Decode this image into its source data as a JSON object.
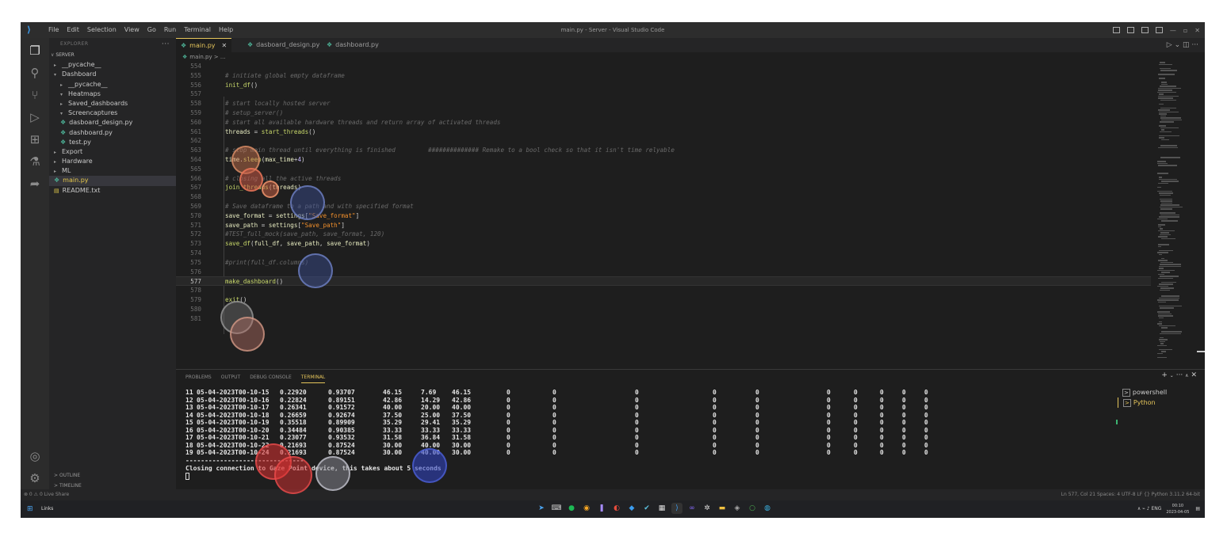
{
  "titlebar": {
    "menu": [
      "File",
      "Edit",
      "Selection",
      "View",
      "Go",
      "Run",
      "Terminal",
      "Help"
    ],
    "title": "main.py - Server - Visual Studio Code"
  },
  "explorer": {
    "header": "EXPLORER",
    "root": "SERVER",
    "items": [
      {
        "label": "__pycache__",
        "level": 1,
        "kind": "folder",
        "open": false
      },
      {
        "label": "Dashboard",
        "level": 1,
        "kind": "folder",
        "open": true
      },
      {
        "label": "__pycache__",
        "level": 2,
        "kind": "folder",
        "open": false
      },
      {
        "label": "Heatmaps",
        "level": 2,
        "kind": "folder",
        "open": true
      },
      {
        "label": "Saved_dashboards",
        "level": 2,
        "kind": "folder",
        "open": false
      },
      {
        "label": "Screencaptures",
        "level": 2,
        "kind": "folder",
        "open": true
      },
      {
        "label": "dasboard_design.py",
        "level": 2,
        "kind": "py"
      },
      {
        "label": "dashboard.py",
        "level": 2,
        "kind": "py"
      },
      {
        "label": "test.py",
        "level": 2,
        "kind": "py"
      },
      {
        "label": "Export",
        "level": 1,
        "kind": "folder",
        "open": false
      },
      {
        "label": "Hardware",
        "level": 1,
        "kind": "folder",
        "open": false
      },
      {
        "label": "ML",
        "level": 1,
        "kind": "folder",
        "open": false
      },
      {
        "label": "main.py",
        "level": 1,
        "kind": "py",
        "selected": true
      },
      {
        "label": "README.txt",
        "level": 1,
        "kind": "txt"
      }
    ],
    "outline": "OUTLINE",
    "timeline": "TIMELINE"
  },
  "tabs": [
    {
      "label": "main.py",
      "active": true
    },
    {
      "label": "dasboard_design.py",
      "active": false
    },
    {
      "label": "dashboard.py",
      "active": false
    }
  ],
  "breadcrumb": "main.py > ...",
  "code": [
    {
      "n": "554",
      "t": []
    },
    {
      "n": "555",
      "t": [
        [
          "cm",
          "# initiate global empty dataframe"
        ]
      ]
    },
    {
      "n": "556",
      "t": [
        [
          "fn",
          "init_df"
        ],
        [
          "pl",
          "()"
        ]
      ]
    },
    {
      "n": "557",
      "t": []
    },
    {
      "n": "558",
      "t": [
        [
          "cm",
          "# start locally hosted server"
        ]
      ]
    },
    {
      "n": "559",
      "t": [
        [
          "cm",
          "# setup_server()"
        ]
      ]
    },
    {
      "n": "560",
      "t": [
        [
          "cm",
          "# start all available hardware threads and return array of activated threads"
        ]
      ]
    },
    {
      "n": "561",
      "t": [
        [
          "va",
          "threads"
        ],
        [
          "pl",
          " = "
        ],
        [
          "fn",
          "start_threads"
        ],
        [
          "pl",
          "()"
        ]
      ]
    },
    {
      "n": "562",
      "t": []
    },
    {
      "n": "563",
      "t": [
        [
          "cm",
          "# stop main thread until everything is finished         ############## Remake to a bool check so that it isn't time relyable"
        ]
      ]
    },
    {
      "n": "564",
      "t": [
        [
          "va",
          "time"
        ],
        [
          "pl",
          "."
        ],
        [
          "fn",
          "sleep"
        ],
        [
          "pl",
          "("
        ],
        [
          "va",
          "max_time"
        ],
        [
          "pl",
          "+"
        ],
        [
          "nu",
          "4"
        ],
        [
          "pl",
          ")"
        ]
      ]
    },
    {
      "n": "565",
      "t": []
    },
    {
      "n": "566",
      "t": [
        [
          "cm",
          "# closing all the active threads"
        ]
      ]
    },
    {
      "n": "567",
      "t": [
        [
          "fn",
          "join_threads"
        ],
        [
          "pl",
          "("
        ],
        [
          "va",
          "threads"
        ],
        [
          "pl",
          ")"
        ]
      ]
    },
    {
      "n": "568",
      "t": []
    },
    {
      "n": "569",
      "t": [
        [
          "cm",
          "# Save dataframe to a path and with specified format"
        ]
      ]
    },
    {
      "n": "570",
      "t": [
        [
          "va",
          "save_format"
        ],
        [
          "pl",
          " = "
        ],
        [
          "va",
          "settings"
        ],
        [
          "pl",
          "["
        ],
        [
          "st",
          "\"Save_format\""
        ],
        [
          "pl",
          "]"
        ]
      ]
    },
    {
      "n": "571",
      "t": [
        [
          "va",
          "save_path"
        ],
        [
          "pl",
          " = "
        ],
        [
          "va",
          "settings"
        ],
        [
          "pl",
          "["
        ],
        [
          "st",
          "\"Save_path\""
        ],
        [
          "pl",
          "]"
        ]
      ]
    },
    {
      "n": "572",
      "t": [
        [
          "cm",
          "#TEST_full_mock(save_path, save_format, 120)"
        ]
      ]
    },
    {
      "n": "573",
      "t": [
        [
          "fn",
          "save_df"
        ],
        [
          "pl",
          "("
        ],
        [
          "va",
          "full_df"
        ],
        [
          "pl",
          ", "
        ],
        [
          "va",
          "save_path"
        ],
        [
          "pl",
          ", "
        ],
        [
          "va",
          "save_format"
        ],
        [
          "pl",
          ")"
        ]
      ]
    },
    {
      "n": "574",
      "t": []
    },
    {
      "n": "575",
      "t": [
        [
          "cm",
          "#print(full_df.columns)"
        ]
      ]
    },
    {
      "n": "576",
      "t": []
    },
    {
      "n": "577",
      "t": [
        [
          "fn",
          "make_dashboard"
        ],
        [
          "pl",
          "()"
        ]
      ],
      "current": true
    },
    {
      "n": "578",
      "t": []
    },
    {
      "n": "579",
      "t": [
        [
          "fn",
          "exit"
        ],
        [
          "pl",
          "()"
        ]
      ]
    },
    {
      "n": "580",
      "t": []
    },
    {
      "n": "581",
      "t": []
    }
  ],
  "panel": {
    "tabs": [
      "PROBLEMS",
      "OUTPUT",
      "DEBUG CONSOLE",
      "TERMINAL"
    ],
    "active": "TERMINAL",
    "rows": [
      [
        "11",
        "05-04-2023T00-10-15",
        "0.22920",
        "0.93707",
        "46.15",
        "7.69",
        "46.15",
        "0",
        "0",
        "0",
        "0",
        "0",
        "0",
        "0",
        "0",
        "0",
        "0"
      ],
      [
        "12",
        "05-04-2023T00-10-16",
        "0.22824",
        "0.89151",
        "42.86",
        "14.29",
        "42.86",
        "0",
        "0",
        "0",
        "0",
        "0",
        "0",
        "0",
        "0",
        "0",
        "0"
      ],
      [
        "13",
        "05-04-2023T00-10-17",
        "0.26341",
        "0.91572",
        "40.00",
        "20.00",
        "40.00",
        "0",
        "0",
        "0",
        "0",
        "0",
        "0",
        "0",
        "0",
        "0",
        "0"
      ],
      [
        "14",
        "05-04-2023T00-10-18",
        "0.26659",
        "0.92674",
        "37.50",
        "25.00",
        "37.50",
        "0",
        "0",
        "0",
        "0",
        "0",
        "0",
        "0",
        "0",
        "0",
        "0"
      ],
      [
        "15",
        "05-04-2023T00-10-19",
        "0.35518",
        "0.89909",
        "35.29",
        "29.41",
        "35.29",
        "0",
        "0",
        "0",
        "0",
        "0",
        "0",
        "0",
        "0",
        "0",
        "0"
      ],
      [
        "16",
        "05-04-2023T00-10-20",
        "0.34484",
        "0.90385",
        "33.33",
        "33.33",
        "33.33",
        "0",
        "0",
        "0",
        "0",
        "0",
        "0",
        "0",
        "0",
        "0",
        "0"
      ],
      [
        "17",
        "05-04-2023T00-10-21",
        "0.23077",
        "0.93532",
        "31.58",
        "36.84",
        "31.58",
        "0",
        "0",
        "0",
        "0",
        "0",
        "0",
        "0",
        "0",
        "0",
        "0"
      ],
      [
        "18",
        "05-04-2023T00-10-22",
        "0.21693",
        "0.87524",
        "30.00",
        "40.00",
        "30.00",
        "0",
        "0",
        "0",
        "0",
        "0",
        "0",
        "0",
        "0",
        "0",
        "0"
      ],
      [
        "19",
        "05-04-2023T00-10-24",
        "0.21693",
        "0.87524",
        "30.00",
        "40.00",
        "30.00",
        "0",
        "0",
        "0",
        "0",
        "0",
        "0",
        "0",
        "0",
        "0",
        "0"
      ]
    ],
    "separator": "-------------------------------",
    "message": "Closing connection to Gaze Point device, this takes about 5 seconds",
    "shells": [
      "powershell",
      "Python"
    ]
  },
  "status": {
    "left": "⊗ 0 ⚠ 0   Live Share",
    "right": "Ln 577, Col 21   Spaces: 4   UTF-8   LF   {} Python   3.11.2 64-bit"
  },
  "taskbar": {
    "links": "Links",
    "lang": "ENG",
    "time": "00:10",
    "date": "2023-04-05"
  },
  "colors": {
    "accent": "#e5c55b",
    "python_icon": "#4caf94",
    "gaze_red": "#d23c3c",
    "gaze_blue": "#3c50b4"
  }
}
